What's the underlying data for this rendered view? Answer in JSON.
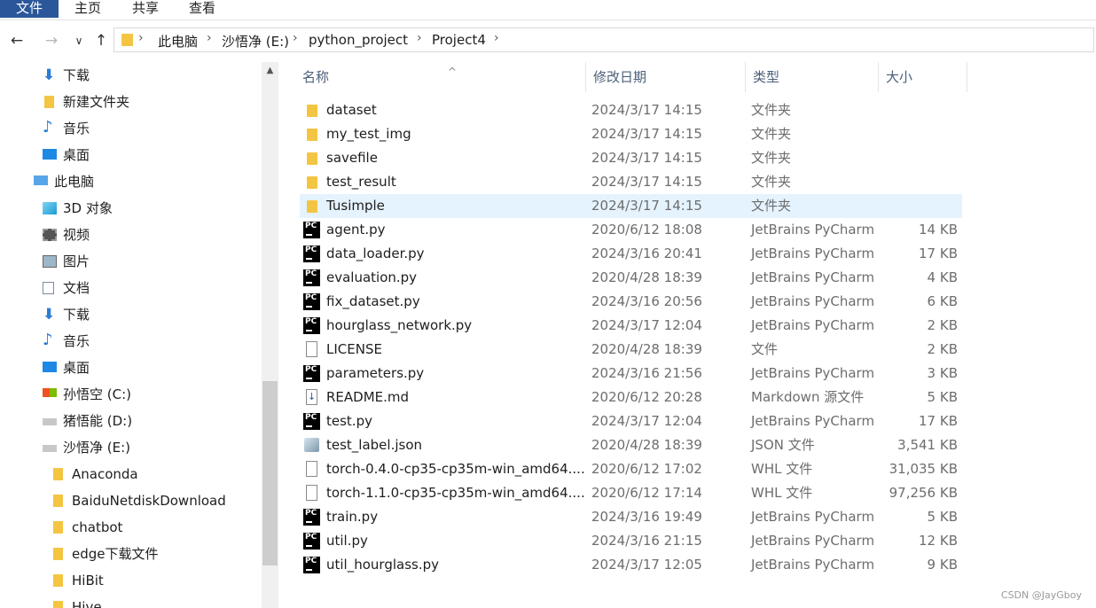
{
  "ribbon": {
    "tabs": [
      "文件",
      "主页",
      "共享",
      "查看"
    ]
  },
  "address": {
    "crumbs": [
      "此电脑",
      "沙悟净 (E:)",
      "python_project",
      "Project4"
    ]
  },
  "nav_icons": {
    "back": "←",
    "forward": "→",
    "recent": "∨",
    "up": "↑"
  },
  "sidebar": {
    "items": [
      {
        "label": "下载",
        "icon": "download-icon"
      },
      {
        "label": "新建文件夹",
        "icon": "folder-icon"
      },
      {
        "label": "音乐",
        "icon": "music-icon"
      },
      {
        "label": "桌面",
        "icon": "desktop-icon"
      },
      {
        "label": "此电脑",
        "icon": "this-pc-icon"
      },
      {
        "label": "3D 对象",
        "icon": "3d-objects-icon"
      },
      {
        "label": "视频",
        "icon": "video-icon"
      },
      {
        "label": "图片",
        "icon": "pictures-icon"
      },
      {
        "label": "文档",
        "icon": "documents-icon"
      },
      {
        "label": "下载",
        "icon": "download-icon"
      },
      {
        "label": "音乐",
        "icon": "music-icon"
      },
      {
        "label": "桌面",
        "icon": "desktop-icon"
      },
      {
        "label": "孙悟空 (C:)",
        "icon": "system-drive-icon"
      },
      {
        "label": "猪悟能 (D:)",
        "icon": "drive-icon"
      },
      {
        "label": "沙悟净 (E:)",
        "icon": "drive-icon"
      },
      {
        "label": "Anaconda",
        "icon": "folder-icon"
      },
      {
        "label": "BaiduNetdiskDownload",
        "icon": "folder-icon"
      },
      {
        "label": "chatbot",
        "icon": "folder-icon"
      },
      {
        "label": "edge下载文件",
        "icon": "folder-icon"
      },
      {
        "label": "HiBit",
        "icon": "folder-icon"
      },
      {
        "label": "Hive",
        "icon": "folder-icon"
      }
    ]
  },
  "columns": {
    "name": "名称",
    "date": "修改日期",
    "type": "类型",
    "size": "大小"
  },
  "files": [
    {
      "name": "dataset",
      "date": "2024/3/17 14:15",
      "type": "文件夹",
      "size": "",
      "icon": "folder"
    },
    {
      "name": "my_test_img",
      "date": "2024/3/17 14:15",
      "type": "文件夹",
      "size": "",
      "icon": "folder"
    },
    {
      "name": "savefile",
      "date": "2024/3/17 14:15",
      "type": "文件夹",
      "size": "",
      "icon": "folder"
    },
    {
      "name": "test_result",
      "date": "2024/3/17 14:15",
      "type": "文件夹",
      "size": "",
      "icon": "folder"
    },
    {
      "name": "Tusimple",
      "date": "2024/3/17 14:15",
      "type": "文件夹",
      "size": "",
      "icon": "folder",
      "selected": true
    },
    {
      "name": "agent.py",
      "date": "2020/6/12 18:08",
      "type": "JetBrains PyCharm",
      "size": "14 KB",
      "icon": "pycharm"
    },
    {
      "name": "data_loader.py",
      "date": "2024/3/16 20:41",
      "type": "JetBrains PyCharm",
      "size": "17 KB",
      "icon": "pycharm"
    },
    {
      "name": "evaluation.py",
      "date": "2020/4/28 18:39",
      "type": "JetBrains PyCharm",
      "size": "4 KB",
      "icon": "pycharm"
    },
    {
      "name": "fix_dataset.py",
      "date": "2024/3/16 20:56",
      "type": "JetBrains PyCharm",
      "size": "6 KB",
      "icon": "pycharm"
    },
    {
      "name": "hourglass_network.py",
      "date": "2024/3/17 12:04",
      "type": "JetBrains PyCharm",
      "size": "2 KB",
      "icon": "pycharm"
    },
    {
      "name": "LICENSE",
      "date": "2020/4/28 18:39",
      "type": "文件",
      "size": "2 KB",
      "icon": "file"
    },
    {
      "name": "parameters.py",
      "date": "2024/3/16 21:56",
      "type": "JetBrains PyCharm",
      "size": "3 KB",
      "icon": "pycharm"
    },
    {
      "name": "README.md",
      "date": "2020/6/12 20:28",
      "type": "Markdown 源文件",
      "size": "5 KB",
      "icon": "markdown"
    },
    {
      "name": "test.py",
      "date": "2024/3/17 12:04",
      "type": "JetBrains PyCharm",
      "size": "17 KB",
      "icon": "pycharm"
    },
    {
      "name": "test_label.json",
      "date": "2020/4/28 18:39",
      "type": "JSON 文件",
      "size": "3,541 KB",
      "icon": "json"
    },
    {
      "name": "torch-0.4.0-cp35-cp35m-win_amd64....",
      "date": "2020/6/12 17:02",
      "type": "WHL 文件",
      "size": "31,035 KB",
      "icon": "file"
    },
    {
      "name": "torch-1.1.0-cp35-cp35m-win_amd64....",
      "date": "2020/6/12 17:14",
      "type": "WHL 文件",
      "size": "97,256 KB",
      "icon": "file"
    },
    {
      "name": "train.py",
      "date": "2024/3/16 19:49",
      "type": "JetBrains PyCharm",
      "size": "5 KB",
      "icon": "pycharm"
    },
    {
      "name": "util.py",
      "date": "2024/3/16 21:15",
      "type": "JetBrains PyCharm",
      "size": "12 KB",
      "icon": "pycharm"
    },
    {
      "name": "util_hourglass.py",
      "date": "2024/3/17 12:05",
      "type": "JetBrains PyCharm",
      "size": "9 KB",
      "icon": "pycharm"
    }
  ],
  "watermark": "CSDN @JayGboy",
  "colors": {
    "accent": "#2b579a",
    "selected_row": "#e5f3ff",
    "folder": "#f4c542"
  }
}
